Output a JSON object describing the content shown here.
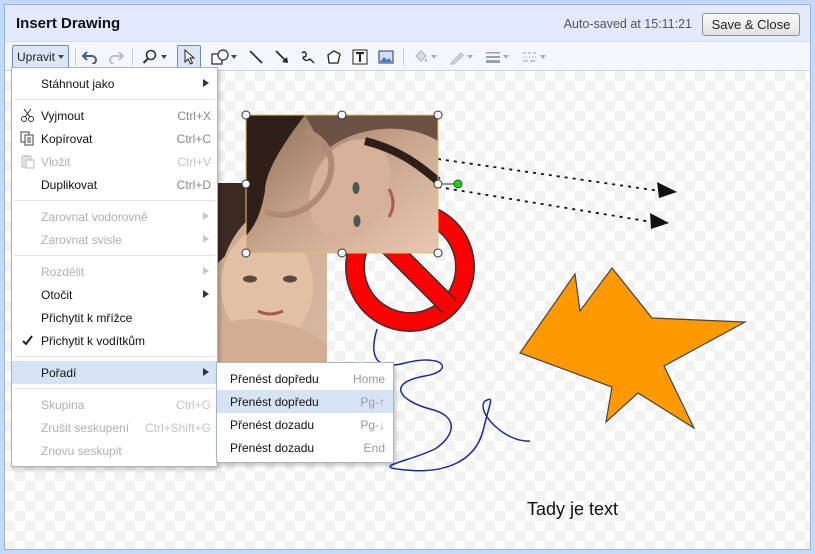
{
  "dialog": {
    "title": "Insert Drawing",
    "autosave": "Auto-saved at 15:11:21",
    "save_close": "Save & Close"
  },
  "toolbar": {
    "edit_menu_label": "Upravit",
    "tools": [
      "undo-icon",
      "redo-icon",
      "zoom-icon",
      "select-icon",
      "shape-icon",
      "line-icon",
      "arrow-icon",
      "scribble-icon",
      "polygon-icon",
      "textbox-icon",
      "image-icon",
      "fill-color-icon",
      "line-color-icon",
      "line-weight-icon",
      "line-dash-icon"
    ]
  },
  "edit_menu": {
    "items": [
      {
        "label": "Stáhnout jako",
        "shortcut": "",
        "submenu": true,
        "disabled": false
      },
      {
        "label": "Vyjmout",
        "shortcut": "Ctrl+X",
        "icon": "scissors-icon",
        "disabled": false
      },
      {
        "label": "Kopírovat",
        "shortcut": "Ctrl+C",
        "icon": "copy-icon",
        "disabled": false
      },
      {
        "label": "Vložit",
        "shortcut": "Ctrl+V",
        "icon": "paste-icon",
        "disabled": true
      },
      {
        "label": "Duplikovat",
        "shortcut": "Ctrl+D",
        "disabled": false
      },
      {
        "label": "Zarovnat vodorovně",
        "shortcut": "",
        "submenu": true,
        "disabled": true
      },
      {
        "label": "Zarovnat svisle",
        "shortcut": "",
        "submenu": true,
        "disabled": true
      },
      {
        "label": "Rozdělit",
        "shortcut": "",
        "submenu": true,
        "disabled": true
      },
      {
        "label": "Otočit",
        "shortcut": "",
        "submenu": true,
        "disabled": false
      },
      {
        "label": "Přichytit k mřížce",
        "shortcut": "",
        "disabled": false
      },
      {
        "label": "Přichytit k vodítkům",
        "shortcut": "",
        "checked": true,
        "disabled": false
      },
      {
        "label": "Pořadí",
        "shortcut": "",
        "submenu": true,
        "highlighted": true,
        "disabled": false
      },
      {
        "label": "Skupina",
        "shortcut": "Ctrl+G",
        "disabled": true
      },
      {
        "label": "Zrušit seskupení",
        "shortcut": "Ctrl+Shift+G",
        "disabled": true
      },
      {
        "label": "Znovu seskupit",
        "shortcut": "",
        "disabled": true
      }
    ]
  },
  "order_menu": {
    "items": [
      {
        "label": "Přenést dopředu",
        "shortcut": "Home"
      },
      {
        "label": "Přenést dopředu",
        "shortcut": "Pg-↑",
        "highlighted": true
      },
      {
        "label": "Přenést dozadu",
        "shortcut": "Pg-↓"
      },
      {
        "label": "Přenést dozadu",
        "shortcut": "End"
      }
    ]
  },
  "canvas": {
    "text": "Tady je text",
    "colors": {
      "star": "#ff9900",
      "prohibition": "#ff0000",
      "scribble": "#1a2a9e",
      "connector_handle": "#22cc22"
    }
  }
}
